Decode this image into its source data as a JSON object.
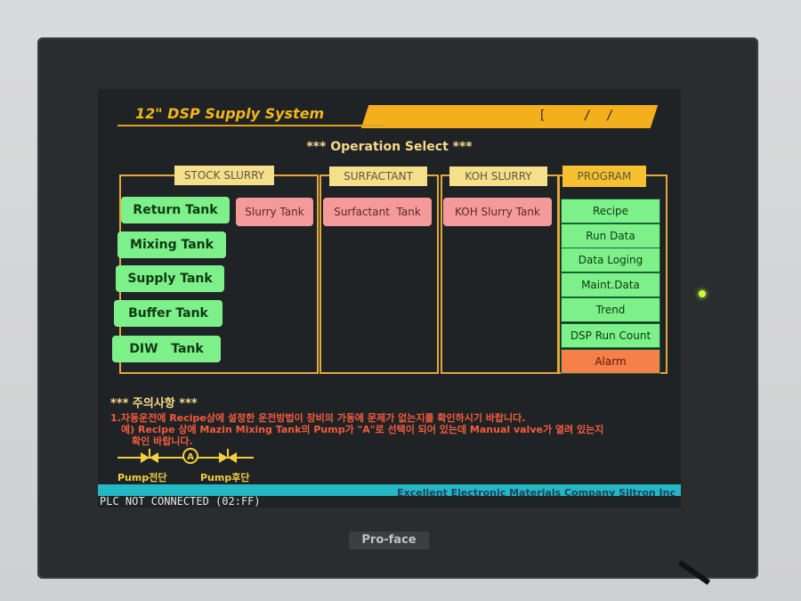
{
  "device": {
    "brand": "Pro-face"
  },
  "header": {
    "title": "12\" DSP Supply System",
    "date": "[     /  /          ]"
  },
  "operation_select": "*** Operation Select ***",
  "sections": {
    "stock_slurry": {
      "label": "STOCK SLURRY",
      "buttons": [
        "Return Tank",
        "Mixing Tank",
        "Supply Tank",
        "Buffer Tank",
        "DIW   Tank"
      ],
      "tank": "Slurry Tank"
    },
    "surfactant": {
      "label": "SURFACTANT",
      "tank": "Surfactant  Tank"
    },
    "koh_slurry": {
      "label": "KOH SLURRY",
      "tank": "KOH Slurry Tank"
    },
    "program": {
      "label": "PROGRAM",
      "items": [
        "Recipe",
        "Run Data",
        "Data Loging",
        "Maint.Data",
        "Trend",
        "DSP Run Count",
        "Alarm"
      ]
    }
  },
  "caution": {
    "title": "*** 주의사항 ***",
    "line1": "1.자동운전에 Recipe상에 설정한 운전방법이 장비의 가동에 문제가 없는지를 확인하시기 바랍니다.",
    "line2": "예) Recipe 상에 Mazin Mixing Tank의 Pump가 \"A\"로 선택이 되어 있는데 Manual valve가 열려 있는지",
    "line3": "확인 바랍니다.",
    "pump_before": "Pump전단",
    "pump_after": "Pump후단",
    "pump_symbol": "A"
  },
  "ticker": "Excellent Electronic Materials Company    Siltron Inc",
  "status": "PLC NOT CONNECTED (02:FF)",
  "colors": {
    "accent": "#f3b01c",
    "button_green": "#7ef08a",
    "button_pink": "#f59a9a",
    "alarm": "#f5804a",
    "warning_text": "#f55b3c",
    "ticker": "#22b8c4"
  }
}
